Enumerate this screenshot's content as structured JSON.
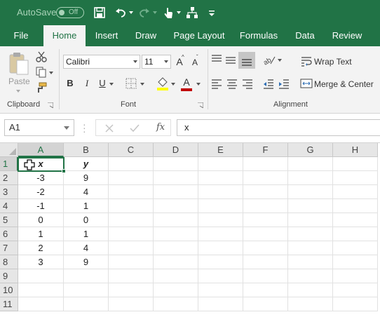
{
  "qat": {
    "autosave_label": "AutoSave",
    "toggle_state": "Off"
  },
  "tabs": [
    "File",
    "Home",
    "Insert",
    "Draw",
    "Page Layout",
    "Formulas",
    "Data",
    "Review"
  ],
  "ribbon": {
    "paste_label": "Paste",
    "font_name": "Calibri",
    "font_size": "11",
    "grow_label": "A",
    "shrink_label": "A",
    "bold": "B",
    "italic": "I",
    "underline": "U",
    "font_color_label": "A",
    "wrap_text": "Wrap Text",
    "merge_center": "Merge & Center",
    "groups": {
      "clipboard": "Clipboard",
      "font": "Font",
      "alignment": "Alignment"
    }
  },
  "formula_bar": {
    "name_box": "A1",
    "fx": "fx",
    "content": "x"
  },
  "sheet": {
    "columns": [
      "A",
      "B",
      "C",
      "D",
      "E",
      "F",
      "G",
      "H"
    ],
    "rows": [
      "1",
      "2",
      "3",
      "4",
      "5",
      "6",
      "7",
      "8",
      "9",
      "10",
      "11"
    ],
    "data": [
      [
        "x",
        "y"
      ],
      [
        "-3",
        "9"
      ],
      [
        "-2",
        "4"
      ],
      [
        "-1",
        "1"
      ],
      [
        "0",
        "0"
      ],
      [
        "1",
        "1"
      ],
      [
        "2",
        "4"
      ],
      [
        "3",
        "9"
      ]
    ],
    "active_cell": "A1"
  },
  "colors": {
    "excel_green": "#217346",
    "ribbon_bg": "#f3f3f3",
    "header_bg": "#e6e6e6"
  }
}
